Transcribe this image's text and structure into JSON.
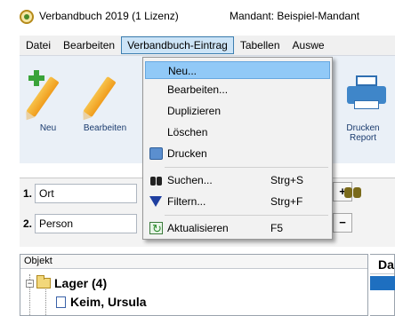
{
  "window": {
    "title": "Verbandbuch 2019  (1 Lizenz)",
    "mandant": "Mandant: Beispiel-Mandant"
  },
  "menubar": {
    "items": [
      "Datei",
      "Bearbeiten",
      "Verbandbuch-Eintrag",
      "Tabellen",
      "Auswe"
    ]
  },
  "toolbar": {
    "new_label": "Neu",
    "edit_label": "Bearbeiten",
    "print_label_1": "Drucken",
    "print_label_2": "Report"
  },
  "dropdown": {
    "items": [
      {
        "label": "Neu...",
        "shortcut": ""
      },
      {
        "label": "Bearbeiten...",
        "shortcut": ""
      },
      {
        "label": "Duplizieren",
        "shortcut": ""
      },
      {
        "label": "Löschen",
        "shortcut": ""
      },
      {
        "label": "Drucken",
        "shortcut": ""
      },
      {
        "label": "Suchen...",
        "shortcut": "Strg+S"
      },
      {
        "label": "Filtern...",
        "shortcut": "Strg+F"
      },
      {
        "label": "Aktualisieren",
        "shortcut": "F5"
      }
    ]
  },
  "filters": {
    "rows": [
      {
        "num": "1.",
        "field": "Ort"
      },
      {
        "num": "2.",
        "field": "Person"
      }
    ],
    "add_button": "+",
    "remove_button": "−"
  },
  "tree": {
    "header": "Objekt",
    "folder_label": "Lager  (4)",
    "item_label": "Keim, Ursula",
    "expander": "−"
  },
  "grid": {
    "header": "Da"
  }
}
